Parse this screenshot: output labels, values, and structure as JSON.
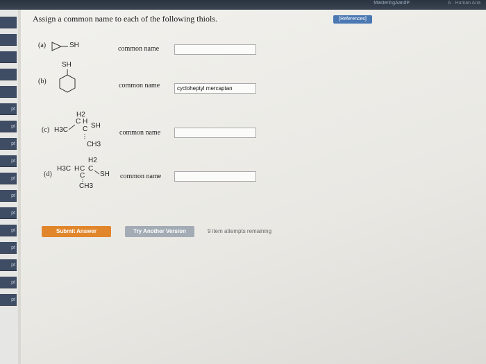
{
  "topbar": {
    "brand": "MasteringAandP",
    "user": "A · Human Ana"
  },
  "sidebar": {
    "points": [
      "",
      "",
      "",
      "",
      "",
      "pt",
      "pt",
      "pt",
      "pt",
      "pt",
      "pt",
      "pt",
      "pt",
      "pt",
      "pt",
      "pt",
      "pt"
    ]
  },
  "references_label": "[References]",
  "heading": "Assign a common name to each of the following thiols.",
  "questions": [
    {
      "label": "(a)",
      "field_label": "common name",
      "value": ""
    },
    {
      "label": "(b)",
      "field_label": "common name",
      "value": "cycloheptyl mercaptan"
    },
    {
      "label": "(c)",
      "field_label": "common name",
      "value": ""
    },
    {
      "label": "(d)",
      "field_label": "common name",
      "value": ""
    }
  ],
  "molecules": {
    "a": {
      "sh": "SH"
    },
    "b": {
      "sh": "SH"
    },
    "c": {
      "h2": "H2",
      "h3c": "H3C",
      "c1": "C",
      "h": "H",
      "sh": "SH",
      "c2": "C",
      "ch3": "CH3"
    },
    "d": {
      "h2": "H2",
      "h3c": "H3C",
      "h": "H",
      "c1": "C",
      "c2": "C",
      "sh": "SH",
      "c3": "C",
      "ch3": "CH3"
    }
  },
  "buttons": {
    "submit": "Submit Answer",
    "try_another": "Try Another Version"
  },
  "attempts_text": "9 item attempts remaining"
}
